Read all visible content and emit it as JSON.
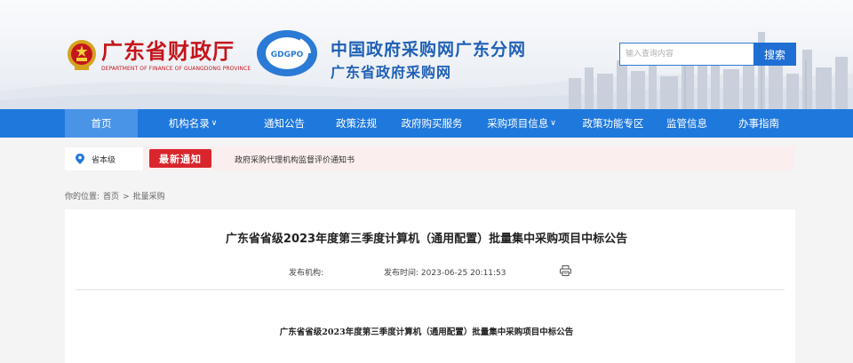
{
  "header": {
    "mof_title": "广东省财政厅",
    "mof_subtitle": "DEPARTMENT OF FINANCE OF GUANGDONG PROVINCE",
    "logo_text": "GDGPO",
    "site_title": "中国政府采购网广东分网",
    "site_subtitle": "广东省政府采购网",
    "search_placeholder": "输入查询内容",
    "search_button": "搜索"
  },
  "nav": {
    "items": [
      {
        "label": "首页"
      },
      {
        "label": "机构名录"
      },
      {
        "label": "通知公告"
      },
      {
        "label": "政策法规"
      },
      {
        "label": "政府购买服务"
      },
      {
        "label": "采购项目信息"
      },
      {
        "label": "政策功能专区"
      },
      {
        "label": "监管信息"
      },
      {
        "label": "办事指南"
      }
    ],
    "dropdown_marker": "∨"
  },
  "notice": {
    "level": "省本级",
    "badge": "最新通知",
    "text": "政府采购代理机构监督评价通知书"
  },
  "breadcrumb": {
    "prefix": "你的位置:",
    "home": "首页",
    "separator": ">",
    "current": "批量采购"
  },
  "article": {
    "title": "广东省省级2023年度第三季度计算机（通用配置）批量集中采购项目中标公告",
    "publisher_label": "发布机构:",
    "time_label": "发布时间:",
    "time_value": "2023-06-25 20:11:53",
    "body_title": "广东省省级2023年度第三季度计算机（通用配置）批量集中采购项目中标公告"
  },
  "colors": {
    "nav_bg": "#1f78dc",
    "nav_active": "#4a94e8",
    "brand_red": "#c4161c",
    "brand_blue": "#1f60b6",
    "badge_red": "#d9262c"
  }
}
